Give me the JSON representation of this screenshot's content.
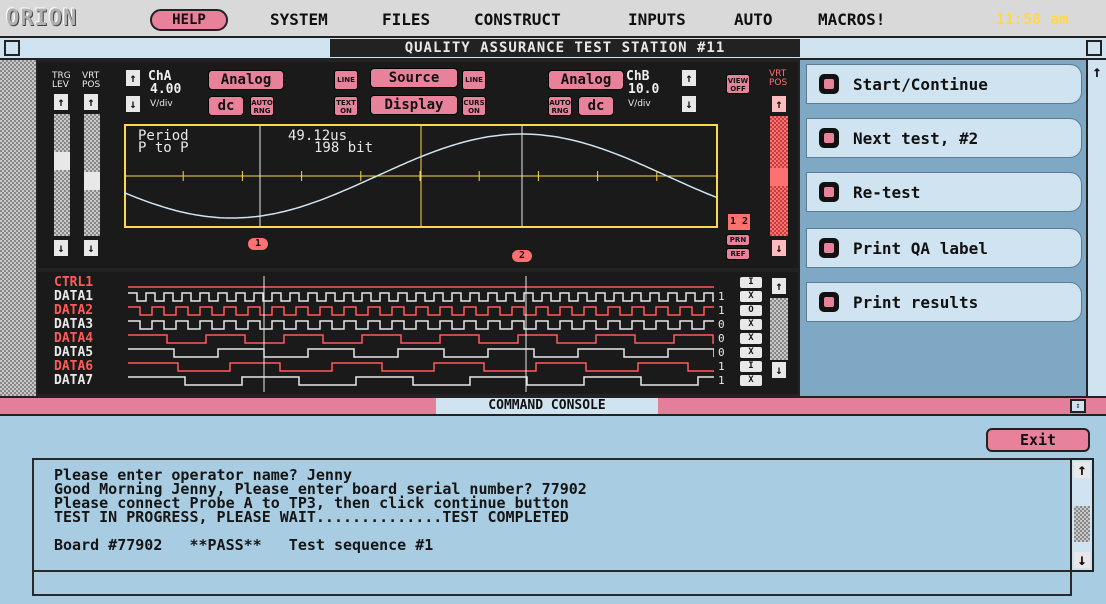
{
  "menubar": {
    "logo": "ORION",
    "help": "HELP",
    "items": [
      "SYSTEM",
      "FILES",
      "CONSTRUCT",
      "INPUTS",
      "AUTO",
      "MACROS!"
    ],
    "clock": "11:58 am"
  },
  "window": {
    "title": "QUALITY ASSURANCE TEST STATION #11"
  },
  "scope": {
    "trg_lev": "TRG LEV",
    "vrt_pos": "VRT POS",
    "cha": {
      "name": "ChA",
      "value": "4.00",
      "unit": "V/div"
    },
    "chb": {
      "name": "ChB",
      "value": "10.0",
      "unit": "V/div"
    },
    "buttons": {
      "analog_a": "Analog",
      "dc_a": "dc",
      "auto_rng_a": "AUTO RNG",
      "line_l": "LINE",
      "source": "Source",
      "line_r": "LINE",
      "text_on": "TEXT ON",
      "display": "Display",
      "curs_on": "CURS ON",
      "analog_b": "Analog",
      "dc_b": "dc",
      "auto_rng_b": "AUTO RNG",
      "view_off": "VIEW OFF",
      "vrt_pos_r": "VRT POS",
      "prn": "PRN",
      "ref": "REF",
      "marker1": "1",
      "marker2": "2",
      "ch12": "1 2"
    },
    "readout": {
      "period_label": "Period",
      "period_value": "49.12us",
      "ptp_label": "P to P",
      "ptp_value": "198 bit"
    }
  },
  "logic": {
    "channels": [
      {
        "name": "CTRL1",
        "value": "",
        "color": "#ff5a5a"
      },
      {
        "name": "DATA1",
        "value": "1",
        "color": "#e8e8e8"
      },
      {
        "name": "DATA2",
        "value": "1",
        "color": "#ff5a5a"
      },
      {
        "name": "DATA3",
        "value": "0",
        "color": "#e8e8e8"
      },
      {
        "name": "DATA4",
        "value": "0",
        "color": "#ff5a5a"
      },
      {
        "name": "DATA5",
        "value": "0",
        "color": "#e8e8e8"
      },
      {
        "name": "DATA6",
        "value": "1",
        "color": "#ff5a5a"
      },
      {
        "name": "DATA7",
        "value": "1",
        "color": "#e8e8e8"
      }
    ],
    "flags": [
      "I",
      "X",
      "O",
      "X",
      "X",
      "X",
      "I",
      "X"
    ]
  },
  "actions": [
    {
      "label": "Start/Continue"
    },
    {
      "label": "Next test, #2"
    },
    {
      "label": "Re-test"
    },
    {
      "label": "Print QA label"
    },
    {
      "label": "Print results"
    }
  ],
  "console": {
    "title": "COMMAND CONSOLE",
    "exit": "Exit",
    "lines": [
      "Please enter operator name? Jenny",
      "Good Morning Jenny, Please enter board serial number? 77902",
      "Please connect Probe A to TP3, then click continue button",
      "TEST IN PROGRESS, PLEASE WAIT..............TEST COMPLETED"
    ],
    "result": "Board #77902   **PASS**   Test sequence #1"
  },
  "colors": {
    "accent": "#e8829a",
    "panel": "#cfe3f0",
    "grid": "#ffd84a",
    "trace": "#cfe3f0"
  }
}
